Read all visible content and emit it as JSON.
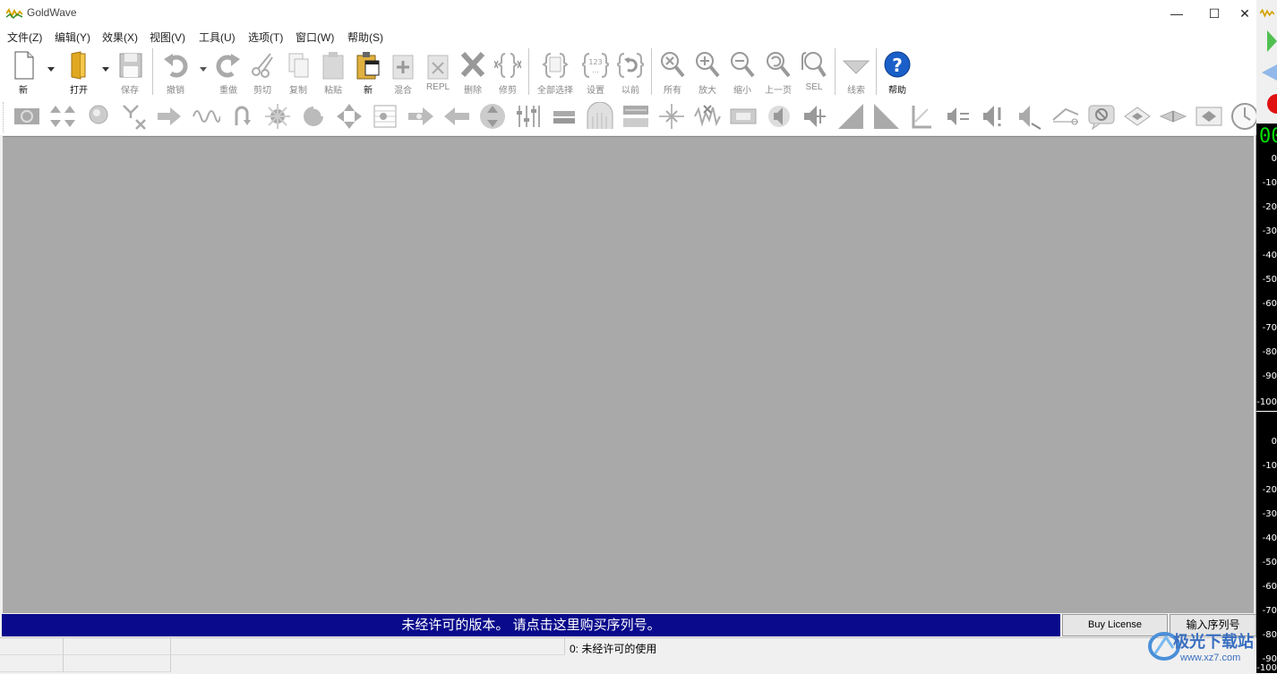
{
  "window": {
    "title": "GoldWave",
    "controls": {
      "minimize": "—",
      "maximize": "☐",
      "close": "✕"
    }
  },
  "menu": [
    "文件(Z)",
    "编辑(Y)",
    "效果(X)",
    "视图(V)",
    "工具(U)",
    "选项(T)",
    "窗口(W)",
    "帮助(S)"
  ],
  "toolbar": {
    "new": "新",
    "open": "打开",
    "save": "保存",
    "undo": "撤销",
    "redo": "重做",
    "cut": "剪切",
    "copy": "复制",
    "paste": "粘贴",
    "paste_new": "新",
    "mix": "混合",
    "replace": "REPL",
    "delete": "删除",
    "trim": "修剪",
    "select_all": "全部选择",
    "set": "设置",
    "previous": "以前",
    "all": "所有",
    "zoom_in": "放大",
    "zoom_out": "缩小",
    "prev_page": "上一页",
    "sel": "SEL",
    "cue": "线索",
    "help": "帮助"
  },
  "license": {
    "message": "未经许可的版本。 请点击这里购买序列号。",
    "buy_button": "Buy License",
    "serial_button": "输入序列号"
  },
  "status": {
    "text": "0:  未经许可的使用"
  },
  "side_panel": {
    "time_display": "00",
    "meter_ticks_top": [
      "0",
      "-10",
      "-20",
      "-30",
      "-40",
      "-50",
      "-60",
      "-70",
      "-80",
      "-90",
      "-100"
    ],
    "meter_ticks_bottom": [
      "0",
      "-10",
      "-20",
      "-30",
      "-40",
      "-50",
      "-60",
      "-70",
      "-80",
      "-90",
      "-100"
    ]
  },
  "watermark": {
    "line1": "极光下载站",
    "line2": "www.xz7.com"
  },
  "colors": {
    "license_bar": "#0a0a8c",
    "workspace": "#a9a9a9",
    "time_display": "#00e000",
    "help_icon": "#1a5fc8"
  }
}
